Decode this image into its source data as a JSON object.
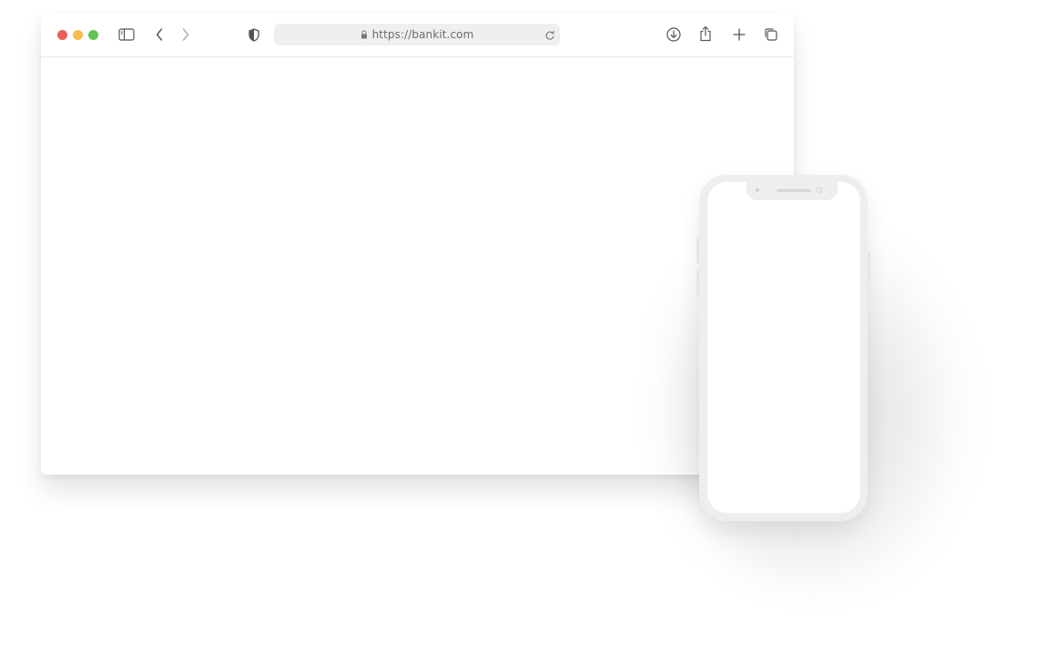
{
  "browser": {
    "traffic_lights": {
      "close_color": "#ec5f59",
      "minimize_color": "#f5be4f",
      "maximize_color": "#5fc455"
    },
    "icons": {
      "sidebar": "sidebar-icon",
      "back": "chevron-left-icon",
      "forward": "chevron-right-icon",
      "privacy": "shield-icon",
      "lock": "lock-icon",
      "reload": "reload-icon",
      "download": "download-icon",
      "share": "share-icon",
      "new_tab": "plus-icon",
      "tabs": "tabs-overview-icon"
    },
    "address_bar": {
      "url": "https://bankit.com"
    },
    "toolbar_icon_color": "#555555",
    "address_bg": "#efefef"
  },
  "phone": {
    "frame_color": "#eeeeee",
    "screen_color": "#ffffff"
  }
}
